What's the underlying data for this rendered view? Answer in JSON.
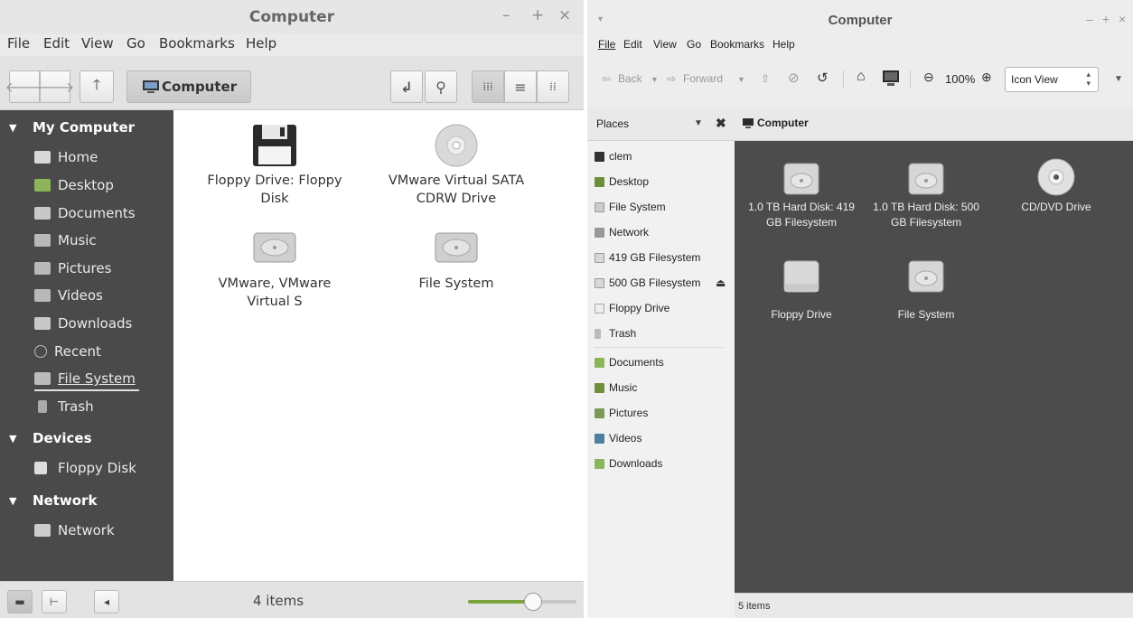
{
  "left": {
    "title": "Computer",
    "window_controls": [
      "–",
      "+",
      "×"
    ],
    "menu": [
      "File",
      "Edit",
      "View",
      "Go",
      "Bookmarks",
      "Help"
    ],
    "location": "Computer",
    "sidebar": {
      "headers": [
        "My Computer",
        "Devices",
        "Network"
      ],
      "my_computer": [
        "Home",
        "Desktop",
        "Documents",
        "Music",
        "Pictures",
        "Videos",
        "Downloads",
        "Recent",
        "File System",
        "Trash"
      ],
      "devices": [
        "Floppy Disk"
      ],
      "network": [
        "Network"
      ]
    },
    "items": [
      {
        "label": "Floppy Drive: Floppy Disk",
        "icon": "floppy-icon"
      },
      {
        "label": "VMware Virtual SATA CDRW Drive",
        "icon": "cdrom-icon"
      },
      {
        "label": "VMware, VMware Virtual S",
        "icon": "harddisk-icon"
      },
      {
        "label": "File System",
        "icon": "harddisk-icon"
      }
    ],
    "status": "4 items",
    "zoom_level": 0.6
  },
  "right": {
    "title": "Computer",
    "window_controls": [
      "–",
      "+",
      "×"
    ],
    "menu": [
      "File",
      "Edit",
      "View",
      "Go",
      "Bookmarks",
      "Help"
    ],
    "toolbar": {
      "back": "Back",
      "forward": "Forward",
      "zoom": "100%",
      "view_mode": "Icon View"
    },
    "places_label": "Places",
    "places": [
      {
        "label": "clem",
        "icon": "home-icon"
      },
      {
        "label": "Desktop",
        "icon": "desktop-icon"
      },
      {
        "label": "File System",
        "icon": "filesystem-icon"
      },
      {
        "label": "Network",
        "icon": "network-icon"
      },
      {
        "label": "419 GB Filesystem",
        "icon": "drive-icon"
      },
      {
        "label": "500 GB Filesystem",
        "icon": "drive-icon"
      },
      {
        "label": "Floppy Drive",
        "icon": "floppy-icon"
      },
      {
        "label": "Trash",
        "icon": "trash-icon"
      },
      {
        "label": "Documents",
        "icon": "folder-icon"
      },
      {
        "label": "Music",
        "icon": "folder-icon"
      },
      {
        "label": "Pictures",
        "icon": "folder-icon"
      },
      {
        "label": "Videos",
        "icon": "folder-icon"
      },
      {
        "label": "Downloads",
        "icon": "folder-icon"
      }
    ],
    "path": "Computer",
    "items": [
      {
        "label": "1.0 TB Hard Disk: 419 GB Filesystem",
        "icon": "harddisk-icon"
      },
      {
        "label": "1.0 TB Hard Disk: 500 GB Filesystem",
        "icon": "harddisk-icon"
      },
      {
        "label": "CD/DVD Drive",
        "icon": "cdrom-icon"
      },
      {
        "label": "Floppy Drive",
        "icon": "floppy-icon"
      },
      {
        "label": "File System",
        "icon": "harddisk-icon"
      }
    ],
    "status": "5 items"
  },
  "colors": {
    "sidebar_dark": "#4a4a4a",
    "content_dark": "#4c4c4c",
    "accent_green": "#7aa33c",
    "folder_green": "#8cb55a"
  }
}
